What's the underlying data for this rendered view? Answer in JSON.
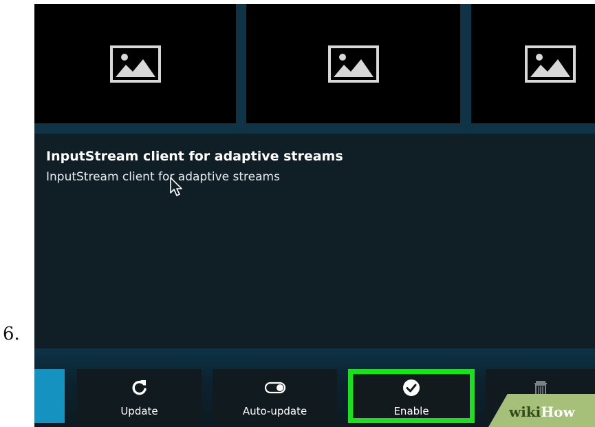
{
  "step": {
    "number": "6."
  },
  "thumbnails": [
    {
      "icon": "image-placeholder-icon"
    },
    {
      "icon": "image-placeholder-icon"
    },
    {
      "icon": "image-placeholder-icon"
    }
  ],
  "addon": {
    "title": "InputStream client for adaptive streams",
    "description": "InputStream client for adaptive streams"
  },
  "toolbar": {
    "update_label": "Update",
    "autoupdate_label": "Auto-update",
    "enable_label": "Enable"
  },
  "watermark": {
    "wiki": "wiki",
    "how": "How"
  },
  "colors": {
    "highlight": "#19e21c",
    "accent_tab": "#1592bf",
    "background": "#0d1a21"
  }
}
